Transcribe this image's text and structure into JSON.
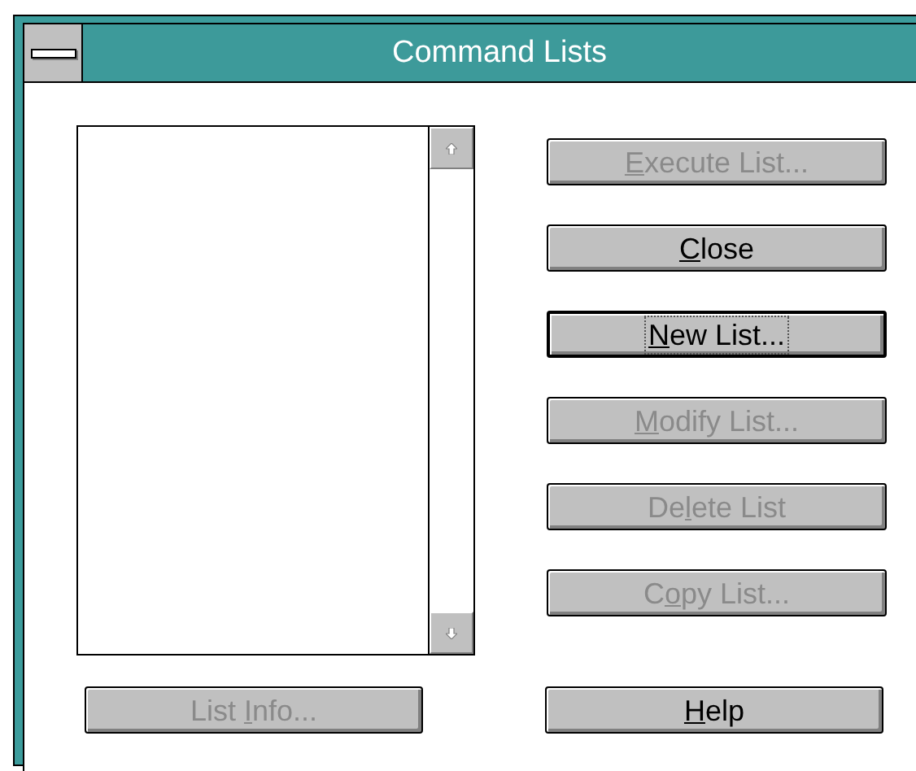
{
  "window": {
    "title": "Command Lists"
  },
  "buttons": [
    {
      "key": "E",
      "after": "xecute List...",
      "disabled": true,
      "default": false
    },
    {
      "key": "C",
      "after": "lose",
      "disabled": false,
      "default": false
    },
    {
      "key": "N",
      "after": "ew List...",
      "disabled": false,
      "default": true
    },
    {
      "key": "M",
      "after": "odify List...",
      "disabled": true,
      "default": false
    },
    {
      "before": "De",
      "key": "l",
      "after": "ete List",
      "disabled": true,
      "default": false
    },
    {
      "before": "C",
      "key": "o",
      "after": "py List...",
      "disabled": true,
      "default": false
    }
  ],
  "bottom_buttons": [
    {
      "before": "List ",
      "key": "I",
      "after": "nfo...",
      "disabled": true,
      "default": false
    },
    {
      "key": "H",
      "after": "elp",
      "disabled": false,
      "default": false
    }
  ]
}
